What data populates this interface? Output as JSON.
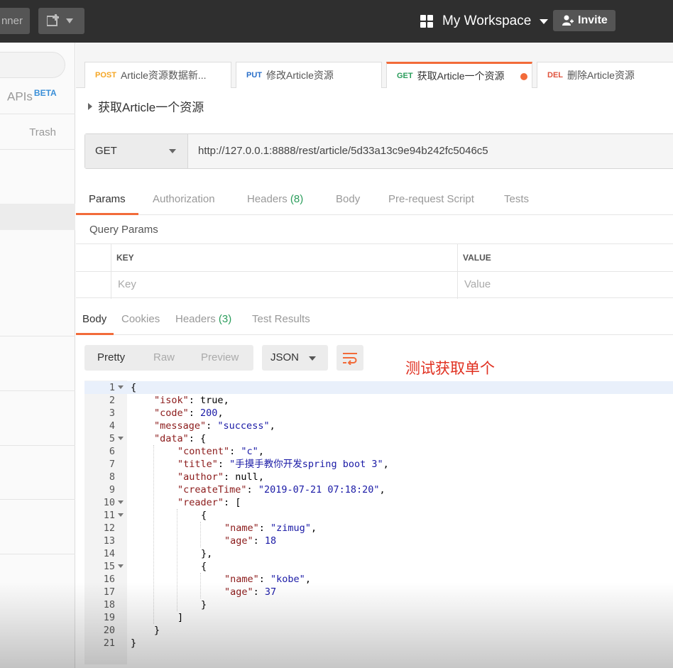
{
  "topbar": {
    "runner_label": "nner",
    "workspace_label": "My Workspace",
    "invite_label": "Invite"
  },
  "sidebar": {
    "apis_label": "APIs",
    "beta_label": "BETA",
    "trash_label": "Trash"
  },
  "tabs": [
    {
      "method": "POST",
      "method_color": "#f5a623",
      "title": "Article资源数据新..."
    },
    {
      "method": "PUT",
      "method_color": "#2a6fc9",
      "title": "修改Article资源"
    },
    {
      "method": "GET",
      "method_color": "#2a9d5b",
      "title": "获取Article一个资源"
    },
    {
      "method": "DEL",
      "method_color": "#e0533d",
      "title": "删除Article资源"
    }
  ],
  "request": {
    "name": "获取Article一个资源",
    "method": "GET",
    "url": "http://127.0.0.1:8888/rest/article/5d33a13c9e94b242fc5046c5"
  },
  "request_tabs": {
    "params": "Params",
    "authorization": "Authorization",
    "headers": "Headers",
    "headers_count": "(8)",
    "body": "Body",
    "prerequest": "Pre-request Script",
    "tests": "Tests"
  },
  "query_params": {
    "title": "Query Params",
    "key_header": "KEY",
    "value_header": "VALUE",
    "key_placeholder": "Key",
    "value_placeholder": "Value"
  },
  "response_tabs": {
    "body": "Body",
    "cookies": "Cookies",
    "headers": "Headers",
    "headers_count": "(3)",
    "test_results": "Test Results"
  },
  "format": {
    "pretty": "Pretty",
    "raw": "Raw",
    "preview": "Preview",
    "language": "JSON"
  },
  "annotation": "测试获取单个",
  "response_lines": [
    {
      "n": "1",
      "fold": true,
      "indent": 0,
      "parts": [
        [
          "p",
          "{"
        ]
      ]
    },
    {
      "n": "2",
      "fold": false,
      "indent": 1,
      "parts": [
        [
          "k",
          "\"isok\""
        ],
        [
          "p",
          ": "
        ],
        [
          "p",
          "true"
        ],
        [
          "p",
          ","
        ]
      ]
    },
    {
      "n": "3",
      "fold": false,
      "indent": 1,
      "parts": [
        [
          "k",
          "\"code\""
        ],
        [
          "p",
          ": "
        ],
        [
          "n",
          "200"
        ],
        [
          "p",
          ","
        ]
      ]
    },
    {
      "n": "4",
      "fold": false,
      "indent": 1,
      "parts": [
        [
          "k",
          "\"message\""
        ],
        [
          "p",
          ": "
        ],
        [
          "s",
          "\"success\""
        ],
        [
          "p",
          ","
        ]
      ]
    },
    {
      "n": "5",
      "fold": true,
      "indent": 1,
      "parts": [
        [
          "k",
          "\"data\""
        ],
        [
          "p",
          ": {"
        ]
      ]
    },
    {
      "n": "6",
      "fold": false,
      "indent": 2,
      "parts": [
        [
          "k",
          "\"content\""
        ],
        [
          "p",
          ": "
        ],
        [
          "s",
          "\"c\""
        ],
        [
          "p",
          ","
        ]
      ]
    },
    {
      "n": "7",
      "fold": false,
      "indent": 2,
      "parts": [
        [
          "k",
          "\"title\""
        ],
        [
          "p",
          ": "
        ],
        [
          "s",
          "\"手摸手教你开发spring boot 3\""
        ],
        [
          "p",
          ","
        ]
      ]
    },
    {
      "n": "8",
      "fold": false,
      "indent": 2,
      "parts": [
        [
          "k",
          "\"author\""
        ],
        [
          "p",
          ": "
        ],
        [
          "p",
          "null"
        ],
        [
          "p",
          ","
        ]
      ]
    },
    {
      "n": "9",
      "fold": false,
      "indent": 2,
      "parts": [
        [
          "k",
          "\"createTime\""
        ],
        [
          "p",
          ": "
        ],
        [
          "s",
          "\"2019-07-21 07:18:20\""
        ],
        [
          "p",
          ","
        ]
      ]
    },
    {
      "n": "10",
      "fold": true,
      "indent": 2,
      "parts": [
        [
          "k",
          "\"reader\""
        ],
        [
          "p",
          ": ["
        ]
      ]
    },
    {
      "n": "11",
      "fold": true,
      "indent": 3,
      "parts": [
        [
          "p",
          "{"
        ]
      ]
    },
    {
      "n": "12",
      "fold": false,
      "indent": 4,
      "parts": [
        [
          "k",
          "\"name\""
        ],
        [
          "p",
          ": "
        ],
        [
          "s",
          "\"zimug\""
        ],
        [
          "p",
          ","
        ]
      ]
    },
    {
      "n": "13",
      "fold": false,
      "indent": 4,
      "parts": [
        [
          "k",
          "\"age\""
        ],
        [
          "p",
          ": "
        ],
        [
          "n",
          "18"
        ]
      ]
    },
    {
      "n": "14",
      "fold": false,
      "indent": 3,
      "parts": [
        [
          "p",
          "},"
        ]
      ]
    },
    {
      "n": "15",
      "fold": true,
      "indent": 3,
      "parts": [
        [
          "p",
          "{"
        ]
      ]
    },
    {
      "n": "16",
      "fold": false,
      "indent": 4,
      "parts": [
        [
          "k",
          "\"name\""
        ],
        [
          "p",
          ": "
        ],
        [
          "s",
          "\"kobe\""
        ],
        [
          "p",
          ","
        ]
      ]
    },
    {
      "n": "17",
      "fold": false,
      "indent": 4,
      "parts": [
        [
          "k",
          "\"age\""
        ],
        [
          "p",
          ": "
        ],
        [
          "n",
          "37"
        ]
      ]
    },
    {
      "n": "18",
      "fold": false,
      "indent": 3,
      "parts": [
        [
          "p",
          "}"
        ]
      ]
    },
    {
      "n": "19",
      "fold": false,
      "indent": 2,
      "parts": [
        [
          "p",
          "]"
        ]
      ]
    },
    {
      "n": "20",
      "fold": false,
      "indent": 1,
      "parts": [
        [
          "p",
          "}"
        ]
      ]
    },
    {
      "n": "21",
      "fold": false,
      "indent": 0,
      "parts": [
        [
          "p",
          "}"
        ]
      ]
    }
  ]
}
